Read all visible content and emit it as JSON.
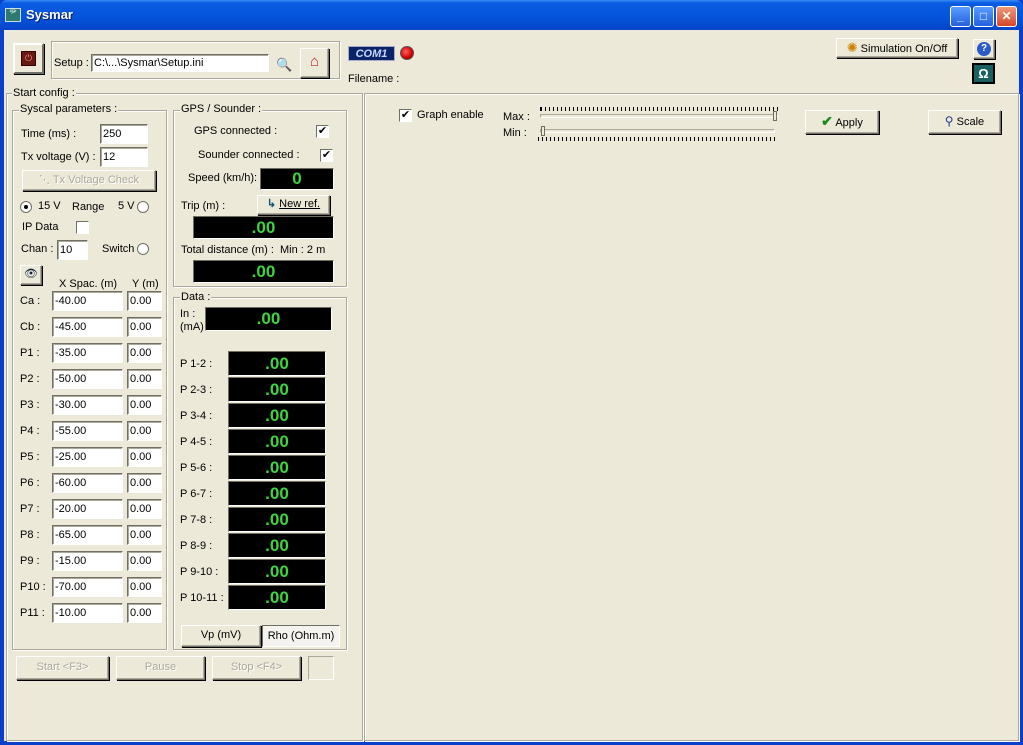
{
  "window": {
    "title": "Sysmar",
    "app_icon": "sysmar-icon",
    "minimize": "_",
    "maximize": "□",
    "close": "✕"
  },
  "top": {
    "setup_label": "Setup :",
    "setup_path": "C:\\...\\Sysmar\\Setup.ini",
    "com_label": "COM1",
    "com_status_color": "#e00000",
    "filename_label": "Filename :",
    "simulation_label": "Simulation On/Off",
    "help_icon": "?",
    "ohm_icon": "Ω"
  },
  "start_config": {
    "title": "Start config :",
    "syscal": {
      "title": "Syscal parameters :",
      "time_label": "Time (ms) :",
      "time_value": "250",
      "tx_label": "Tx voltage  (V) :",
      "tx_value": "12",
      "tx_check_label": "Tx Voltage Check",
      "v15_label": "15 V",
      "range_label": "Range",
      "v5_label": "5 V",
      "ip_label": "IP Data",
      "chan_label": "Chan :",
      "chan_value": "10",
      "switch_label": "Switch",
      "xspac_header": "X Spac. (m)",
      "y_header": "Y (m)",
      "electrodes": [
        {
          "label": "Ca :",
          "x": "-40.00",
          "y": "0.00"
        },
        {
          "label": "Cb :",
          "x": "-45.00",
          "y": "0.00"
        },
        {
          "label": "P1 :",
          "x": "-35.00",
          "y": "0.00"
        },
        {
          "label": "P2 :",
          "x": "-50.00",
          "y": "0.00"
        },
        {
          "label": "P3 :",
          "x": "-30.00",
          "y": "0.00"
        },
        {
          "label": "P4 :",
          "x": "-55.00",
          "y": "0.00"
        },
        {
          "label": "P5 :",
          "x": "-25.00",
          "y": "0.00"
        },
        {
          "label": "P6 :",
          "x": "-60.00",
          "y": "0.00"
        },
        {
          "label": "P7 :",
          "x": "-20.00",
          "y": "0.00"
        },
        {
          "label": "P8 :",
          "x": "-65.00",
          "y": "0.00"
        },
        {
          "label": "P9 :",
          "x": "-15.00",
          "y": "0.00"
        },
        {
          "label": "P10 :",
          "x": "-70.00",
          "y": "0.00"
        },
        {
          "label": "P11 :",
          "x": "-10.00",
          "y": "0.00"
        }
      ]
    },
    "gps": {
      "title": "GPS / Sounder :",
      "gps_label": "GPS connected :",
      "gps_checked": "✔",
      "sounder_label": "Sounder connected :",
      "sounder_checked": "✔",
      "speed_label": "Speed (km/h):",
      "speed_value": "0",
      "trip_label": "Trip (m) :",
      "new_ref_label": "New ref.",
      "trip_value": ".00",
      "total_label": "Total distance (m) :",
      "min_label": "Min : 2 m",
      "total_value": ".00"
    },
    "data": {
      "title": "Data :",
      "in_label": "In :",
      "in_unit": "(mA)",
      "in_value": ".00",
      "dipoles": [
        {
          "label": "P 1-2 :",
          "value": ".00"
        },
        {
          "label": "P 2-3 :",
          "value": ".00"
        },
        {
          "label": "P 3-4 :",
          "value": ".00"
        },
        {
          "label": "P 4-5 :",
          "value": ".00"
        },
        {
          "label": "P 5-6 :",
          "value": ".00"
        },
        {
          "label": "P 6-7 :",
          "value": ".00"
        },
        {
          "label": "P 7-8 :",
          "value": ".00"
        },
        {
          "label": "P 8-9 :",
          "value": ".00"
        },
        {
          "label": "P 9-10 :",
          "value": ".00"
        },
        {
          "label": "P 10-11 :",
          "value": ".00"
        }
      ],
      "vp_tab": "Vp (mV)",
      "rho_tab": "Rho (Ohm.m)"
    },
    "controls": {
      "start": "Start <F3>",
      "pause": "Pause",
      "stop": "Stop <F4>"
    }
  },
  "graph": {
    "enable_label": "Graph enable",
    "enable_checked": "✔",
    "max_label": "Max :",
    "min_label": "Min :",
    "max_position": 1.0,
    "min_position": 0.0,
    "apply_label": "Apply",
    "scale_label": "Scale"
  }
}
